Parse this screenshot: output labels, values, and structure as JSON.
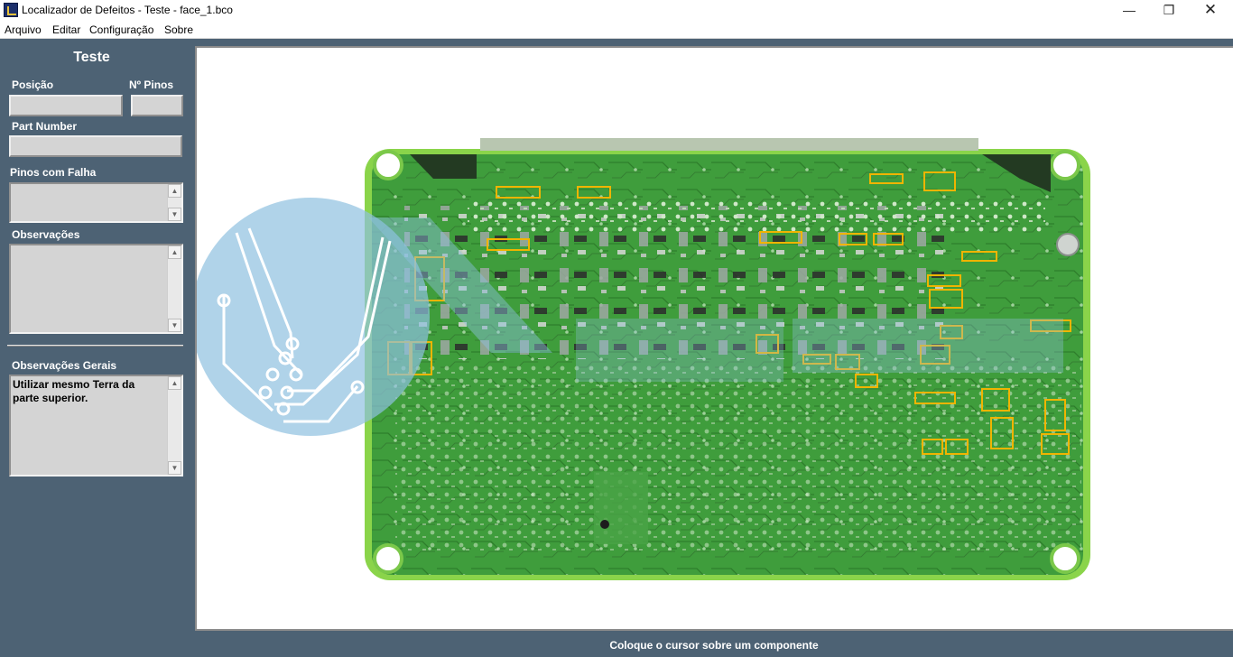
{
  "window": {
    "title": "Localizador de Defeitos - Teste - face_1.bco",
    "min_glyph": "—",
    "max_glyph": "❐",
    "close_glyph": "✕"
  },
  "menu": [
    "Arquivo",
    "Editar",
    "Configuração",
    "Sobre"
  ],
  "panel": {
    "title": "Teste",
    "posicao_label": "Posição",
    "posicao_value": "",
    "npinos_label": "Nº Pinos",
    "npinos_value": "",
    "partnumber_label": "Part Number",
    "partnumber_value": "",
    "pinos_falha_label": "Pinos com Falha",
    "pinos_falha_value": "",
    "observacoes_label": "Observações",
    "observacoes_value": "",
    "obs_gerais_label": "Observações Gerais",
    "obs_gerais_value": "Utilizar mesmo Terra da parte superior."
  },
  "icons": {
    "scroll_up": "▲",
    "scroll_down": "▼"
  },
  "board": {
    "image_alt": "circuit-board-photo",
    "highlight_color": "#f0b400",
    "board_color": "#3f9d3c",
    "edge_color": "#8ad44a"
  },
  "status": "Coloque o cursor sobre um componente"
}
